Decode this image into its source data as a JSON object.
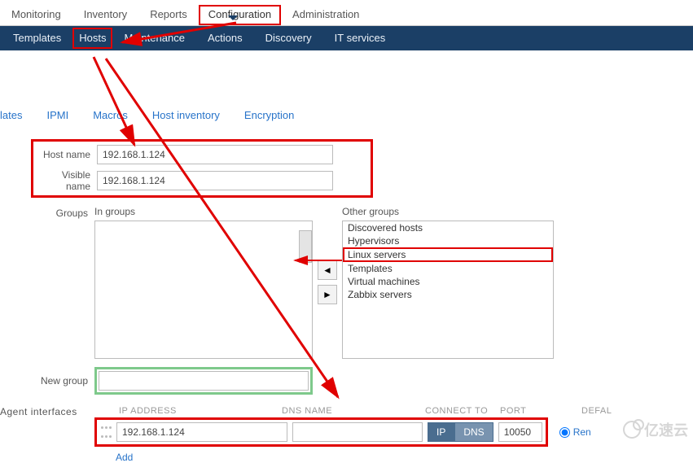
{
  "top_nav": {
    "monitoring": "Monitoring",
    "inventory": "Inventory",
    "reports": "Reports",
    "configuration": "Configuration",
    "administration": "Administration"
  },
  "sub_nav": {
    "templates": "Templates",
    "hosts": "Hosts",
    "maintenance": "Maintenance",
    "actions": "Actions",
    "discovery": "Discovery",
    "it_services": "IT services"
  },
  "tabs": {
    "trunc": "lates",
    "ipmi": "IPMI",
    "macros": "Macros",
    "host_inventory": "Host inventory",
    "encryption": "Encryption"
  },
  "form": {
    "host_name_label": "Host name",
    "host_name_value": "192.168.1.124",
    "visible_name_label": "Visible name",
    "visible_name_value": "192.168.1.124",
    "groups_label": "Groups",
    "in_groups_title": "In groups",
    "other_groups_title": "Other groups",
    "other_groups": {
      "discovered": "Discovered hosts",
      "hypervisors": "Hypervisors",
      "linux": "Linux servers",
      "templates": "Templates",
      "vm": "Virtual machines",
      "zabbix": "Zabbix servers"
    },
    "new_group_label": "New group"
  },
  "agent": {
    "label": "Agent interfaces",
    "col_ip": "IP ADDRESS",
    "col_dns": "DNS NAME",
    "col_connect": "CONNECT TO",
    "col_port": "PORT",
    "col_default": "DEFAL",
    "ip_value": "192.168.1.124",
    "dns_value": "",
    "toggle_ip": "IP",
    "toggle_dns": "DNS",
    "port_value": "10050",
    "remove": "Ren",
    "add": "Add"
  },
  "move_left": "◄",
  "move_right": "►",
  "watermark": "亿速云"
}
